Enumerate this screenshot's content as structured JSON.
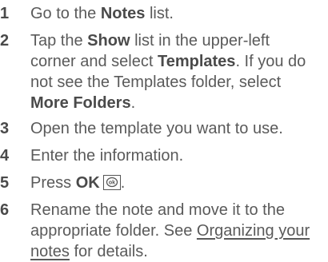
{
  "steps": [
    {
      "number": "1",
      "pre": "Go to the ",
      "bold": "Notes",
      "post": " list."
    },
    {
      "number": "2",
      "line1_pre": "Tap the ",
      "line1_bold": "Show",
      "line1_post": " list in the upper-left",
      "line2_pre": "corner and select ",
      "line2_bold": "Templates",
      "line2_post": ". If you do",
      "line3": "not see the Templates folder, select",
      "line4_bold": "More Folders",
      "line4_post": "."
    },
    {
      "number": "3",
      "text": "Open the template you want to use."
    },
    {
      "number": "4",
      "text": "Enter the information."
    },
    {
      "number": "5",
      "pre": "Press ",
      "bold": "OK",
      "key_icon": "ok-key-icon",
      "post": "."
    },
    {
      "number": "6",
      "line1": "Rename the note and move it to the",
      "line2_pre": "appropriate folder. See ",
      "link_part1": "Organizing your",
      "link_part2": "notes",
      "line3_post": " for details."
    }
  ]
}
